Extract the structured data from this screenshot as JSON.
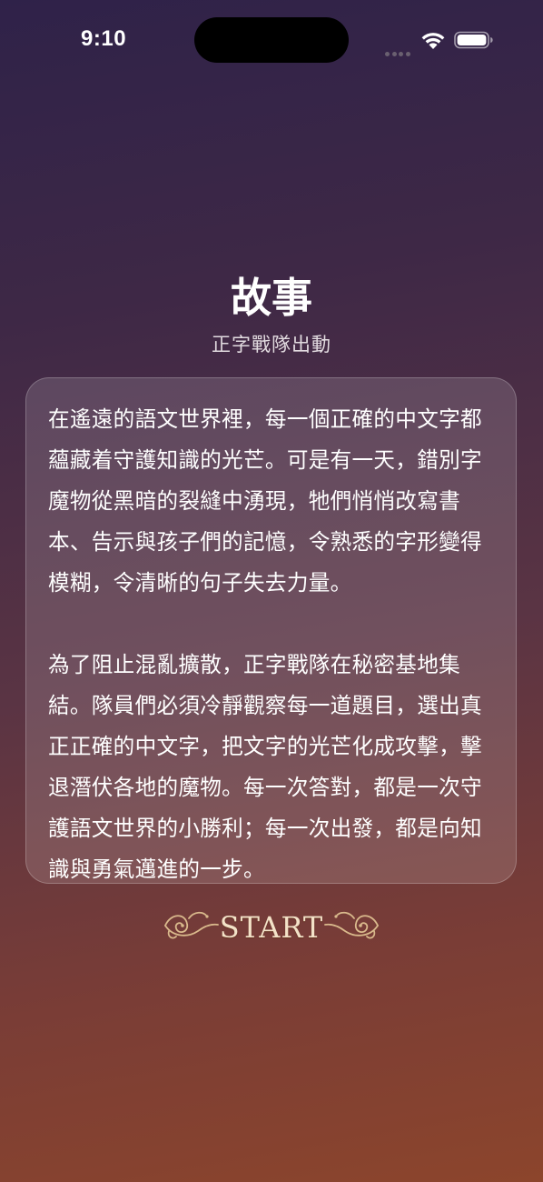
{
  "status_bar": {
    "time": "9:10"
  },
  "header": {
    "title": "故事",
    "subtitle": "正字戰隊出動"
  },
  "story": {
    "paragraphs": [
      "在遙遠的語文世界裡，每一個正確的中文字都蘊藏着守護知識的光芒。可是有一天，錯別字魔物從黑暗的裂縫中湧現，牠們悄悄改寫書本、告示與孩子們的記憶，令熟悉的字形變得模糊，令清晰的句子失去力量。",
      "為了阻止混亂擴散，正字戰隊在秘密基地集結。隊員們必須冷靜觀察每一道題目，選出真正正確的中文字，把文字的光芒化成攻擊，擊退潛伏各地的魔物。每一次答對，都是一次守護語文世界的小勝利；每一次出發，都是向知識與勇氣邁進的一步。"
    ]
  },
  "start_button": {
    "label": "START",
    "ornament_color": "#d9b98c"
  },
  "icons": {
    "signal": "cellular-signal-icon",
    "wifi": "wifi-icon",
    "battery": "battery-icon"
  }
}
